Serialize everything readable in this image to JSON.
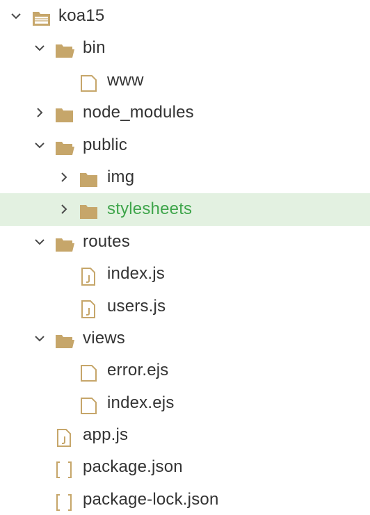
{
  "explorer": {
    "items": [
      {
        "label": "koa15",
        "kind": "folder-open",
        "level": 0,
        "expanded": true
      },
      {
        "label": "bin",
        "kind": "folder-open",
        "level": 1,
        "expanded": true
      },
      {
        "label": "www",
        "kind": "file",
        "level": 2
      },
      {
        "label": "node_modules",
        "kind": "folder-closed",
        "level": 1,
        "expanded": false
      },
      {
        "label": "public",
        "kind": "folder-open",
        "level": 1,
        "expanded": true
      },
      {
        "label": "img",
        "kind": "folder-closed",
        "level": 2,
        "expanded": false
      },
      {
        "label": "stylesheets",
        "kind": "folder-closed",
        "level": 2,
        "expanded": false,
        "selected": true
      },
      {
        "label": "routes",
        "kind": "folder-open",
        "level": 1,
        "expanded": true
      },
      {
        "label": "index.js",
        "kind": "js-file",
        "level": 2
      },
      {
        "label": "users.js",
        "kind": "js-file",
        "level": 2
      },
      {
        "label": "views",
        "kind": "folder-open",
        "level": 1,
        "expanded": true
      },
      {
        "label": "error.ejs",
        "kind": "file",
        "level": 2
      },
      {
        "label": "index.ejs",
        "kind": "file",
        "level": 2
      },
      {
        "label": "app.js",
        "kind": "js-file",
        "level": 1
      },
      {
        "label": "package.json",
        "kind": "json-file",
        "level": 1
      },
      {
        "label": "package-lock.json",
        "kind": "json-file",
        "level": 1
      }
    ]
  },
  "colors": {
    "icon": "#c6a66a",
    "chevron": "#4a4a4a",
    "selected_bg": "#e3f1e1",
    "selected_text": "#3fa54b",
    "text": "#333333"
  }
}
